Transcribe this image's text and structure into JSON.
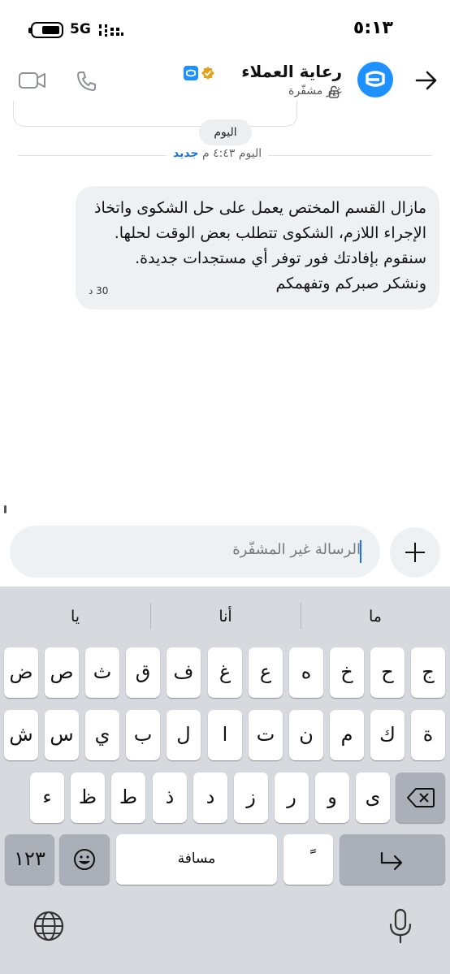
{
  "status_bar": {
    "time": "٥:١٣",
    "network": "5G",
    "battery_level": 0.7
  },
  "header": {
    "contact_name": "رعاية العملاء",
    "encryption_status": "غير مشفّرة",
    "icons": [
      "back-arrow-icon",
      "verified-badge-icon",
      "lock-icon",
      "phone-icon",
      "video-camera-icon"
    ],
    "accent_color": "#1e90ff"
  },
  "chat": {
    "date_chip": "اليوم",
    "new_divider": {
      "timestamp": "اليوم ٤:٤٣ م",
      "new_label": "جديد"
    },
    "messages": [
      {
        "text": "مازال القسم المختص يعمل على حل الشكوى واتخاذ الإجراء اللازم، الشكوى تتطلب بعض الوقت لحلها. سنقوم بإفادتك فور توفر أي مستجدات جديدة. ونشكر صبركم وتفهمكم",
        "time": "30 د"
      }
    ]
  },
  "composer": {
    "placeholder": "الرسالة غير المشفّرة",
    "attach_icon": "plus-icon"
  },
  "keyboard": {
    "suggestions": [
      "ما",
      "أنا",
      "يا"
    ],
    "row1": [
      "ج",
      "ح",
      "خ",
      "ه",
      "ع",
      "غ",
      "ف",
      "ق",
      "ث",
      "ص",
      "ض"
    ],
    "row2": [
      "ة",
      "ك",
      "م",
      "ن",
      "ت",
      "ا",
      "ل",
      "ب",
      "ي",
      "س",
      "ش"
    ],
    "row3": [
      "ى",
      "و",
      "ر",
      "ز",
      "د",
      "ذ",
      "ط",
      "ظ",
      "ء"
    ],
    "numbers_key": "١٢٣",
    "space_key": "مسافة",
    "diacritic_key": "ً",
    "icons": [
      "backspace-icon",
      "emoji-icon",
      "enter-icon",
      "globe-icon",
      "microphone-icon"
    ]
  }
}
